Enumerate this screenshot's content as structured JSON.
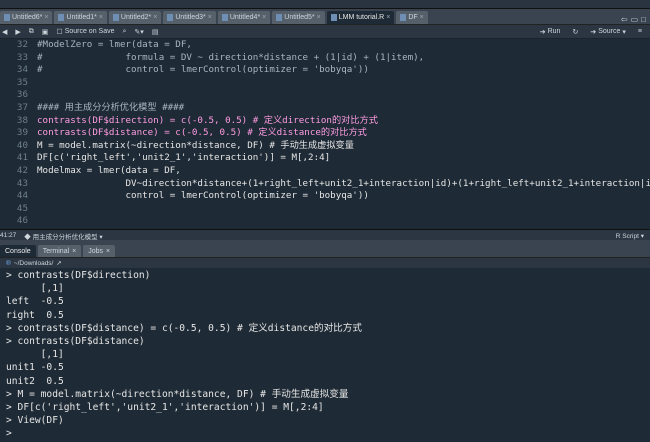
{
  "tabs": [
    {
      "label": "Untitled6*",
      "active": false
    },
    {
      "label": "Untitled1*",
      "active": false
    },
    {
      "label": "Untitled2*",
      "active": false
    },
    {
      "label": "Untitled3*",
      "active": false
    },
    {
      "label": "Untitled4*",
      "active": false
    },
    {
      "label": "Untitled5*",
      "active": false
    },
    {
      "label": "LMM tutorial.R",
      "active": true
    },
    {
      "label": "DF",
      "active": false
    }
  ],
  "toolbar": {
    "source_on_save": "Source on Save",
    "run": "Run",
    "source": "Source"
  },
  "editor": {
    "lines": [
      {
        "n": "32",
        "text": "#ModelZero = lmer(data = DF,"
      },
      {
        "n": "33",
        "text": "#               formula = DV ~ direction*distance + (1|id) + (1|item),"
      },
      {
        "n": "34",
        "text": "#               control = lmerControl(optimizer = 'bobyqa'))"
      },
      {
        "n": "35",
        "text": ""
      },
      {
        "n": "36",
        "text": ""
      },
      {
        "n": "37",
        "text": "#### 用主成分分析优化模型 ####"
      },
      {
        "n": "38",
        "text": "contrasts(DF$direction) = c(-0.5, 0.5) # 定义direction的对比方式"
      },
      {
        "n": "39",
        "text": "contrasts(DF$distance) = c(-0.5, 0.5) # 定义distance的对比方式"
      },
      {
        "n": "40",
        "text": "M = model.matrix(~direction*distance, DF) # 手动生成虚拟变量"
      },
      {
        "n": "40b",
        "text": "DF[c('right_left','unit2_1','interaction')] = M[,2:4]"
      },
      {
        "n": "41",
        "text": "Modelmax = lmer(data = DF,"
      },
      {
        "n": "42",
        "text": "                DV~direction*distance+(1+right_left+unit2_1+interaction|id)+(1+right_left+unit2_1+interaction|it"
      },
      {
        "n": "43",
        "text": "                control = lmerControl(optimizer = 'bobyqa'))"
      },
      {
        "n": "44",
        "text": ""
      },
      {
        "n": "45",
        "text": ""
      },
      {
        "n": "46",
        "text": ""
      },
      {
        "n": "47",
        "text": ""
      }
    ]
  },
  "statusbar": {
    "position": "41:27",
    "section": "用主成分分析优化模型",
    "filetype": "R Script"
  },
  "console_tabs": [
    {
      "label": "Console",
      "active": true
    },
    {
      "label": "Terminal",
      "active": false
    },
    {
      "label": "Jobs",
      "active": false
    }
  ],
  "console_path": "~/Downloads/",
  "console_lines": [
    "> contrasts(DF$direction)",
    "      [,1]",
    "left  -0.5",
    "right  0.5",
    "> contrasts(DF$distance) = c(-0.5, 0.5) # 定义distance的对比方式",
    "> contrasts(DF$distance)",
    "      [,1]",
    "unit1 -0.5",
    "unit2  0.5",
    "> M = model.matrix(~direction*distance, DF) # 手动生成虚拟变量",
    "> DF[c('right_left','unit2_1','interaction')] = M[,2:4]",
    "> View(DF)",
    ">"
  ]
}
